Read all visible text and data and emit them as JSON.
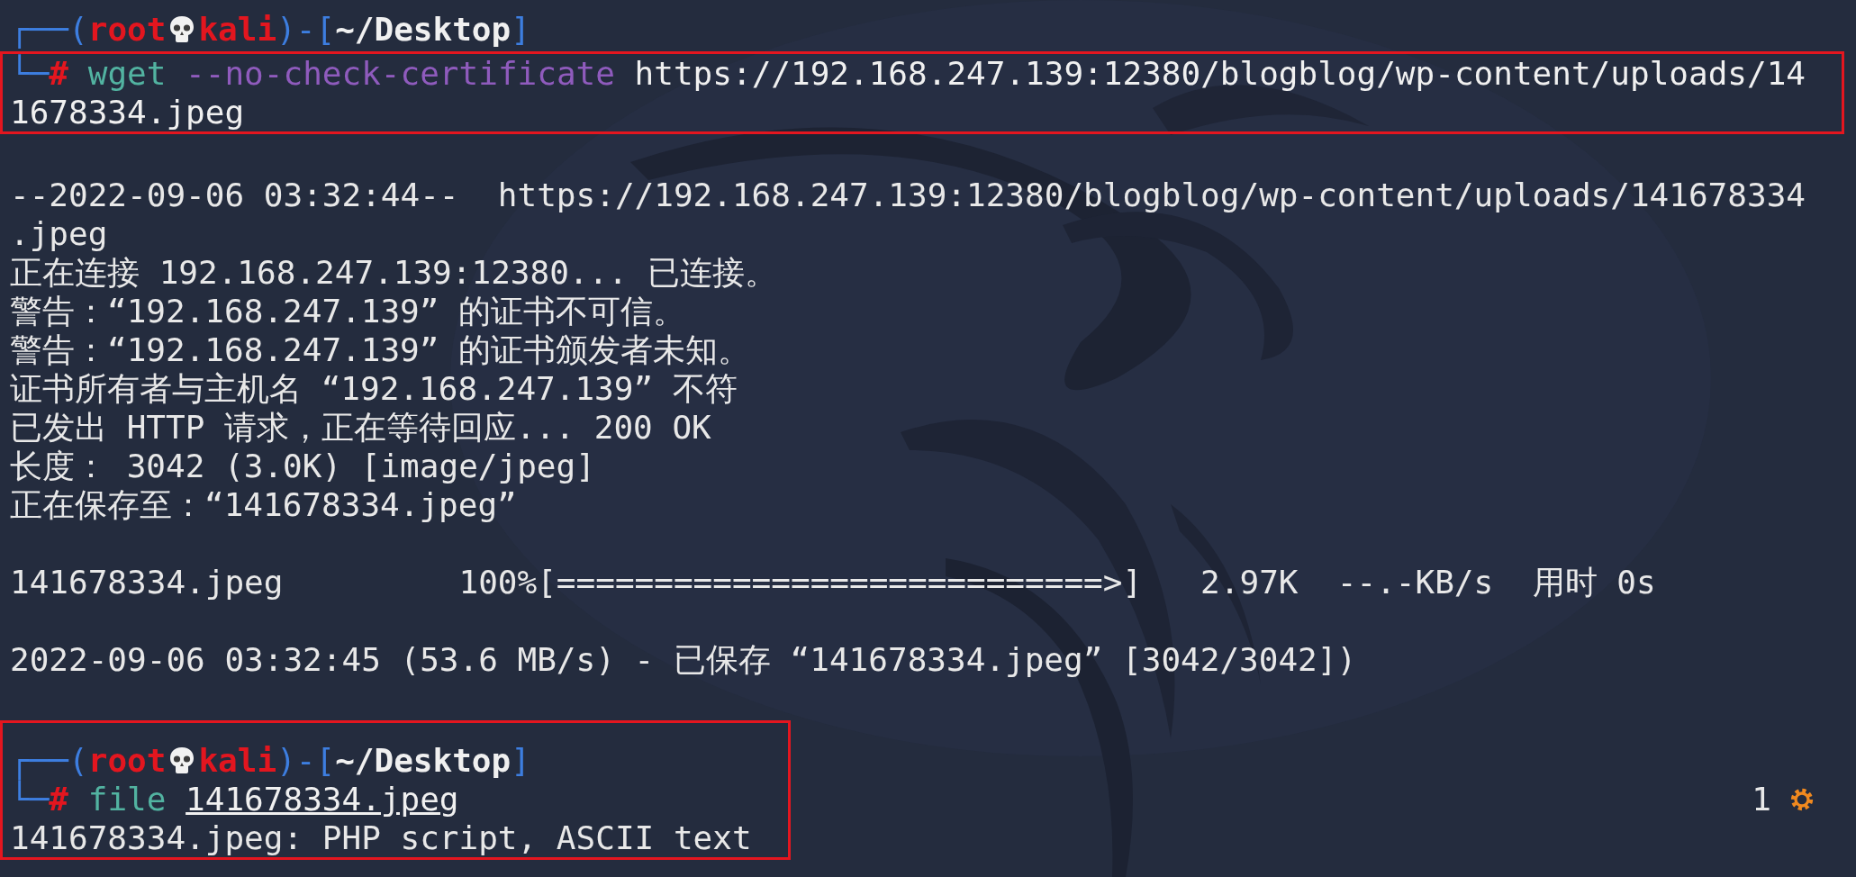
{
  "blocks": [
    {
      "highlighted": false,
      "lines": [
        {
          "kind": "text",
          "segments": [
            {
              "t": "┌──(",
              "kind": "frame"
            },
            {
              "t": "root",
              "kind": "user"
            },
            {
              "kind": "skull"
            },
            {
              "t": "kali",
              "kind": "user"
            },
            {
              "t": ")-[",
              "kind": "frame"
            },
            {
              "t": "~/Desktop",
              "kind": "dir"
            },
            {
              "t": "]",
              "kind": "frame"
            }
          ]
        }
      ]
    },
    {
      "highlighted": true,
      "lines": [
        {
          "kind": "text",
          "segments": [
            {
              "t": "└─",
              "kind": "frame"
            },
            {
              "t": "# ",
              "kind": "hash"
            },
            {
              "t": "wget ",
              "kind": "cmd"
            },
            {
              "t": "--no-check-certificate ",
              "kind": "opt"
            },
            {
              "t": "https://192.168.247.139:12380/blogblog/wp-content/uploads/14",
              "kind": "arg"
            }
          ]
        },
        {
          "kind": "text",
          "segments": [
            {
              "t": "1678334.jpeg",
              "kind": "arg"
            }
          ]
        }
      ]
    },
    {
      "highlighted": false,
      "lines": [
        {
          "kind": "blank"
        },
        {
          "kind": "text",
          "segments": [
            {
              "t": "--2022-09-06 03:32:44--  https://192.168.247.139:12380/blogblog/wp-content/uploads/141678334",
              "kind": "plain"
            }
          ]
        },
        {
          "kind": "text",
          "segments": [
            {
              "t": ".jpeg",
              "kind": "plain"
            }
          ]
        },
        {
          "kind": "text",
          "segments": [
            {
              "t": "正在连接 192.168.247.139:12380... 已连接。",
              "kind": "plain"
            }
          ]
        },
        {
          "kind": "text",
          "segments": [
            {
              "t": "警告：“192.168.247.139” 的证书不可信。",
              "kind": "plain"
            }
          ]
        },
        {
          "kind": "text",
          "segments": [
            {
              "t": "警告：“192.168.247.139” 的证书颁发者未知。",
              "kind": "plain"
            }
          ]
        },
        {
          "kind": "text",
          "segments": [
            {
              "t": "证书所有者与主机名 “192.168.247.139” 不符",
              "kind": "plain"
            }
          ]
        },
        {
          "kind": "text",
          "segments": [
            {
              "t": "已发出 HTTP 请求，正在等待回应... 200 OK",
              "kind": "plain"
            }
          ]
        },
        {
          "kind": "text",
          "segments": [
            {
              "t": "长度： 3042 (3.0K) [image/jpeg]",
              "kind": "plain"
            }
          ]
        },
        {
          "kind": "text",
          "segments": [
            {
              "t": "正在保存至：“141678334.jpeg”",
              "kind": "plain"
            }
          ]
        },
        {
          "kind": "blank"
        },
        {
          "kind": "text",
          "segments": [
            {
              "t": "141678334.jpeg         100%[============================>]   2.97K  --.-KB/s  用时 0s",
              "kind": "plain"
            }
          ]
        },
        {
          "kind": "blank"
        },
        {
          "kind": "text",
          "segments": [
            {
              "t": "2022-09-06 03:32:45 (53.6 MB/s) - 已保存 “141678334.jpeg” [3042/3042])",
              "kind": "plain"
            }
          ]
        },
        {
          "kind": "blank"
        }
      ]
    },
    {
      "highlighted": true,
      "lines": [
        {
          "kind": "text",
          "segments": [
            {
              "t": "┌──(",
              "kind": "frame"
            },
            {
              "t": "root",
              "kind": "user"
            },
            {
              "kind": "skull"
            },
            {
              "t": "kali",
              "kind": "user"
            },
            {
              "t": ")-[",
              "kind": "frame"
            },
            {
              "t": "~/Desktop",
              "kind": "dir"
            },
            {
              "t": "]",
              "kind": "frame"
            }
          ]
        },
        {
          "kind": "text",
          "segments": [
            {
              "t": "└─",
              "kind": "frame"
            },
            {
              "t": "# ",
              "kind": "hash"
            },
            {
              "t": "file ",
              "kind": "cmd"
            },
            {
              "t": "141678334.jpeg",
              "kind": "path"
            }
          ],
          "right": [
            {
              "t": "1",
              "kind": "plain"
            },
            {
              "kind": "gear"
            }
          ]
        },
        {
          "kind": "text",
          "segments": [
            {
              "t": "141678334.jpeg: PHP script, ASCII text",
              "kind": "plain"
            }
          ]
        }
      ]
    }
  ]
}
